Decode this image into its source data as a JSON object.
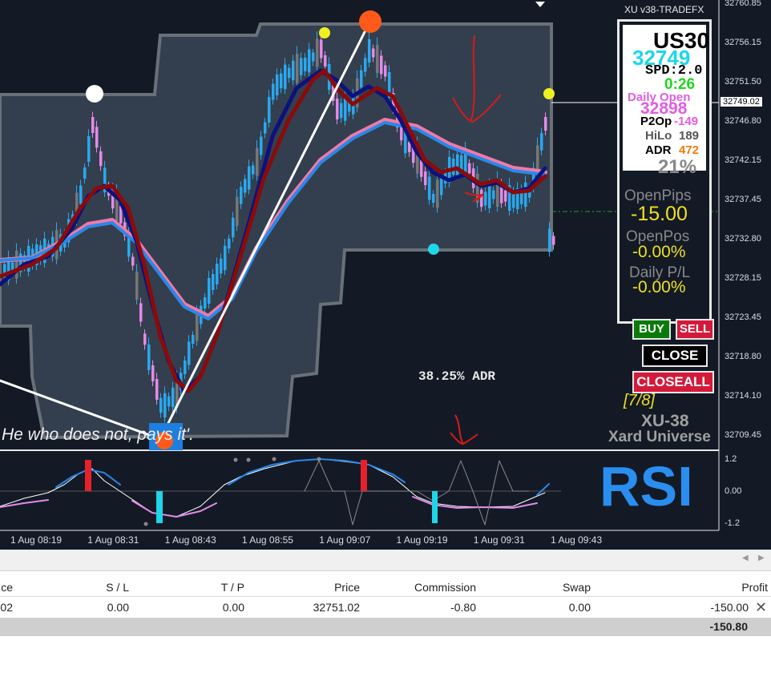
{
  "window": {
    "title": "XU v38-TRADEFX"
  },
  "price_axis": [
    "32760.85",
    "32756.15",
    "32751.50",
    "32746.80",
    "32742.15",
    "32737.45",
    "32732.80",
    "32728.15",
    "32723.45",
    "32718.80",
    "32714.10",
    "32709.45"
  ],
  "price_current": "32749.02",
  "time_axis": [
    "1 Aug 08:19",
    "1 Aug 08:31",
    "1 Aug 08:43",
    "1 Aug 08:55",
    "1 Aug 09:07",
    "1 Aug 09:19",
    "1 Aug 09:31",
    "1 Aug 09:43"
  ],
  "chart": {
    "adr_label": "38.25% ADR",
    "quote": "He who does not, pays it'."
  },
  "info": {
    "symbol": "US30",
    "price": "32749",
    "spread": "SPD:2.0",
    "timer": "0:26",
    "daily_open_label": "Daily Open",
    "daily_open_value": "32898",
    "p2op_label": "P2Op",
    "p2op_value": "-149",
    "hilo_label": "HiLo",
    "hilo_value": "189",
    "adr_label": "ADR",
    "adr_value": "472",
    "percent": "21%",
    "open_pips_label": "OpenPips",
    "open_pips_value": "-15.00",
    "open_pos_label": "OpenPos",
    "open_pos_value": "-0.00%",
    "daily_pl_label": "Daily P/L",
    "daily_pl_value": "-0.00%"
  },
  "buttons": {
    "buy": "BUY",
    "sell": "SELL",
    "close": "CLOSE",
    "close_all": "CLOSEALL"
  },
  "brand": {
    "fraction": "[7/8]",
    "name": "XU-38",
    "sub": "Xard Universe"
  },
  "oscillator": {
    "title": "RSI",
    "levels": [
      "1.2",
      "0.00",
      "-1.2"
    ]
  },
  "table": {
    "headers": [
      "ce",
      "S / L",
      "T / P",
      "Price",
      "Commission",
      "Swap",
      "Profit"
    ],
    "row": [
      "02",
      "0.00",
      "0.00",
      "32751.02",
      "-0.80",
      "0.00",
      "-150.00"
    ],
    "total": "-150.80"
  },
  "colors": {
    "background": "#131a26",
    "bull": "#2aa8ef",
    "bear": "#e38ae8",
    "ma_dark": "#8b0a0a",
    "ma_navy": "#0b127f"
  }
}
